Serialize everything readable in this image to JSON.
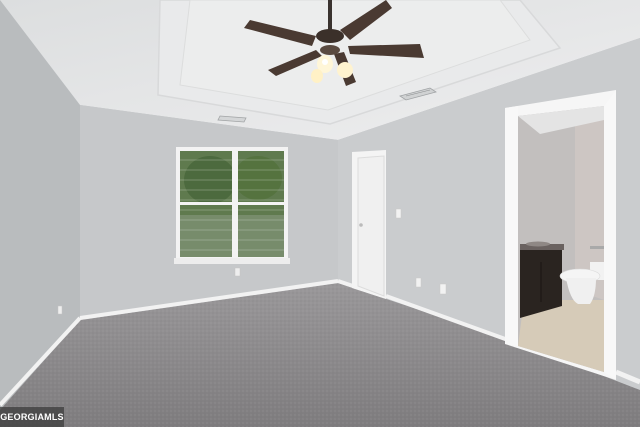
{
  "photo": {
    "watermark": "GEORGIAMLS"
  },
  "colors": {
    "wall_left": "#b9bcbe",
    "wall_back": "#c6c8ca",
    "wall_right": "#caccce",
    "ceiling": "#e6e7e8",
    "carpet": "#8a888a",
    "trim": "#f4f4f4",
    "vanity": "#2a2420",
    "bath_floor": "#d6cbb8",
    "window_foliage": "#5f7a4e"
  },
  "icons": [
    "ceiling-fan-icon",
    "ceiling-vent-icon",
    "light-switch-icon",
    "outlet-icon"
  ]
}
